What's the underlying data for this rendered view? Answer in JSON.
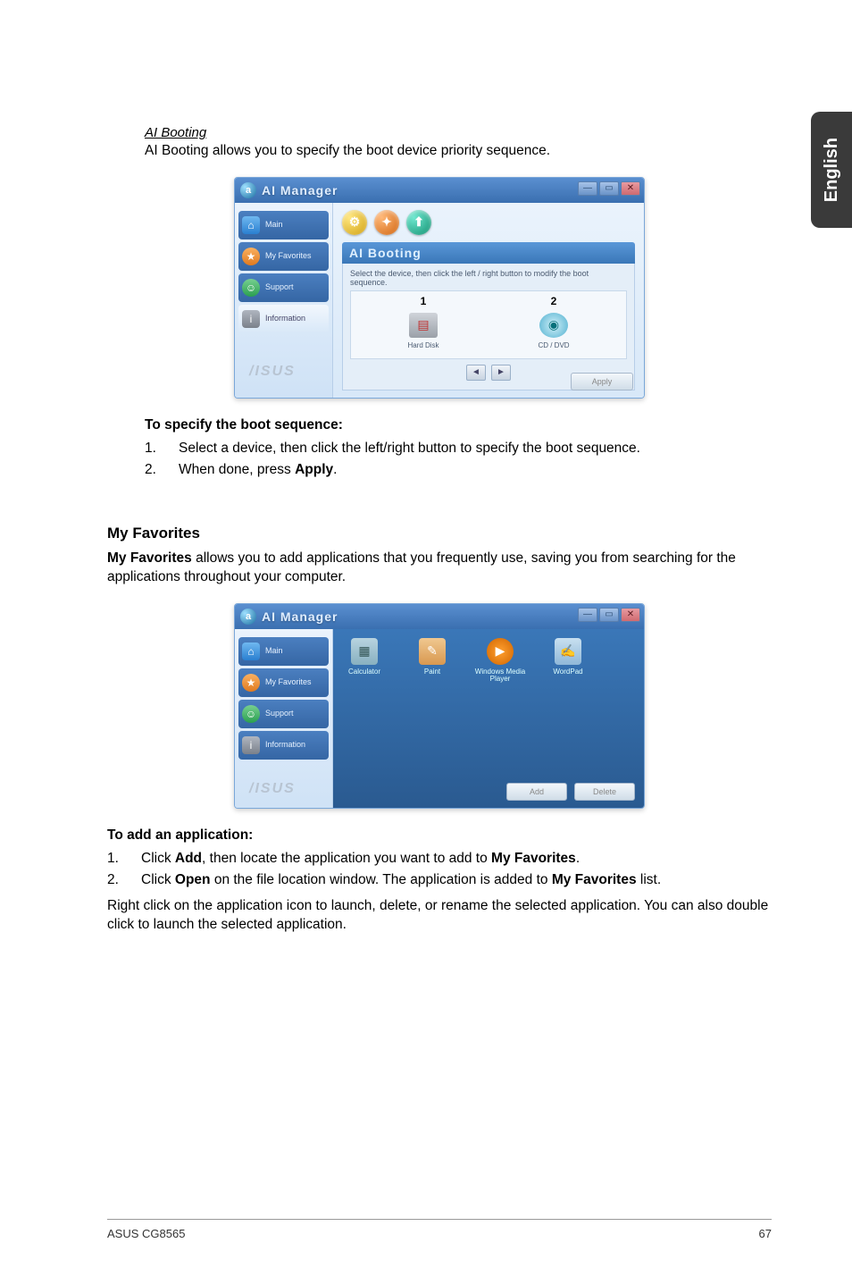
{
  "side_tab": "English",
  "aiboot": {
    "heading": "AI Booting",
    "intro": "AI Booting allows you to specify the boot device priority sequence.",
    "specify_heading": "To specify the boot sequence:",
    "steps": [
      {
        "n": "1.",
        "t_before": "Select a device, then click the left/right button to specify the boot sequence."
      },
      {
        "n": "2.",
        "t_before": "When done, press ",
        "bold": "Apply",
        "t_after": "."
      }
    ],
    "window": {
      "title": "AI Manager",
      "sidebar": [
        "Main",
        "My Favorites",
        "Support",
        "Information"
      ],
      "panel_title": "AI Booting",
      "hint": "Select the device, then click the left / right button to modify the boot sequence.",
      "cols": [
        {
          "num": "1",
          "label": "Hard Disk"
        },
        {
          "num": "2",
          "label": "CD / DVD"
        }
      ],
      "apply": "Apply",
      "brand": "/ISUS"
    }
  },
  "fav": {
    "heading": "My Favorites",
    "intro_bold": "My Favorites",
    "intro_rest": " allows you to add applications that you frequently use, saving you from searching for the applications throughout your computer.",
    "window": {
      "title": "AI Manager",
      "sidebar": [
        "Main",
        "My Favorites",
        "Support",
        "Information"
      ],
      "items": [
        {
          "label": "Calculator"
        },
        {
          "label": "Paint"
        },
        {
          "label": "Windows Media Player"
        },
        {
          "label": "WordPad"
        }
      ],
      "add": "Add",
      "delete": "Delete",
      "brand": "/ISUS"
    },
    "add_heading": "To add an application:",
    "add_steps": [
      {
        "n": "1.",
        "parts": [
          "Click ",
          "Add",
          ", then locate the application you want to add to ",
          "My Favorites",
          "."
        ]
      },
      {
        "n": "2.",
        "parts": [
          "Click ",
          "Open",
          " on the file location window. The application is added to ",
          "My Favorites",
          " list."
        ]
      }
    ],
    "outro": "Right click on the application icon to launch, delete, or rename the selected application. You can also double click to launch the selected application."
  },
  "footer": {
    "left": "ASUS CG8565",
    "right": "67"
  }
}
